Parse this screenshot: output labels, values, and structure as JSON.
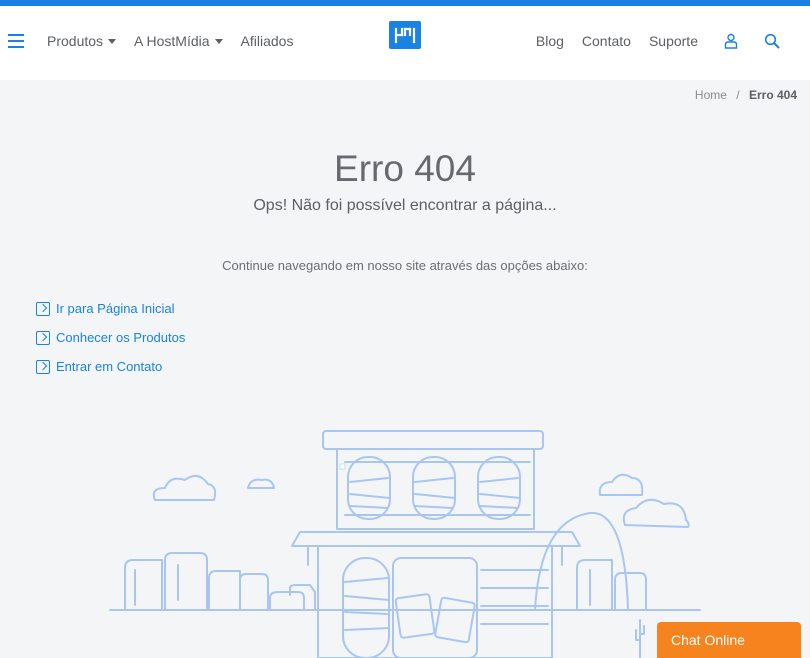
{
  "header": {
    "nav_left": [
      {
        "label": "Produtos",
        "dropdown": true
      },
      {
        "label": "A HostMídia",
        "dropdown": true
      },
      {
        "label": "Afiliados",
        "dropdown": false
      }
    ],
    "nav_right": [
      {
        "label": "Blog"
      },
      {
        "label": "Contato"
      },
      {
        "label": "Suporte"
      }
    ],
    "icons": [
      "menu-icon",
      "user-icon",
      "search-icon"
    ],
    "brand_color": "#1a82e2"
  },
  "breadcrumb": {
    "home": "Home",
    "separator": "/",
    "current": "Erro 404"
  },
  "main": {
    "title": "Erro 404",
    "subtitle": "Ops! Não foi possível encontrar a página...",
    "continue_text": "Continue navegando em nosso site através das opções abaixo:",
    "links": [
      {
        "label": "Ir para Página Inicial"
      },
      {
        "label": "Conhecer os Produtos"
      },
      {
        "label": "Entrar em Contato"
      }
    ]
  },
  "chat": {
    "label": "Chat Online",
    "color": "#f7831e"
  }
}
